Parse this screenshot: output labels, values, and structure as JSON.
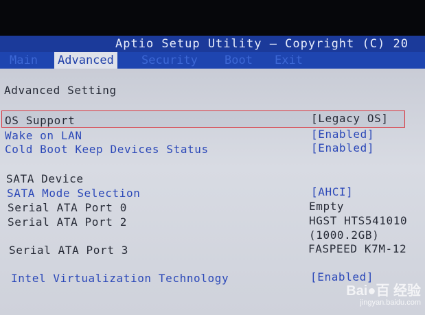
{
  "header": {
    "title": "Aptio Setup Utility – Copyright (C) 20"
  },
  "tabs": [
    {
      "label": "Main",
      "active": false
    },
    {
      "label": "Advanced",
      "active": true
    },
    {
      "label": "Security",
      "active": false
    },
    {
      "label": "Boot",
      "active": false
    },
    {
      "label": "Exit",
      "active": false
    }
  ],
  "section_title": "Advanced Setting",
  "settings": [
    {
      "label": "OS Support",
      "value": "[Legacy OS]",
      "selected": true
    },
    {
      "label": "Wake on LAN",
      "value": "[Enabled]"
    },
    {
      "label": "Cold Boot Keep Devices Status",
      "value": "[Enabled]"
    }
  ],
  "sata": {
    "heading": "SATA Device",
    "mode_label": "SATA Mode Selection",
    "mode_value": "[AHCI]",
    "port0_label": "Serial ATA Port 0",
    "port0_value": "Empty",
    "port2_label": "Serial ATA Port 2",
    "port2_value": "HGST HTS541010",
    "port2_size": "(1000.2GB)",
    "port3_label": "Serial ATA Port 3",
    "port3_value": "FASPEED K7M-12"
  },
  "virtualization": {
    "label": "Intel Virtualization Technology",
    "value": "[Enabled]"
  },
  "colors": {
    "title_bar": "#1b3a9a",
    "tab_bar": "#1e45b0",
    "panel": "#d8dbe3",
    "selectable_text": "#2b48b8",
    "highlight_border": "#d8323b"
  },
  "watermark": {
    "logo": "Bai●百 经验",
    "url": "jingyan.baidu.com"
  }
}
